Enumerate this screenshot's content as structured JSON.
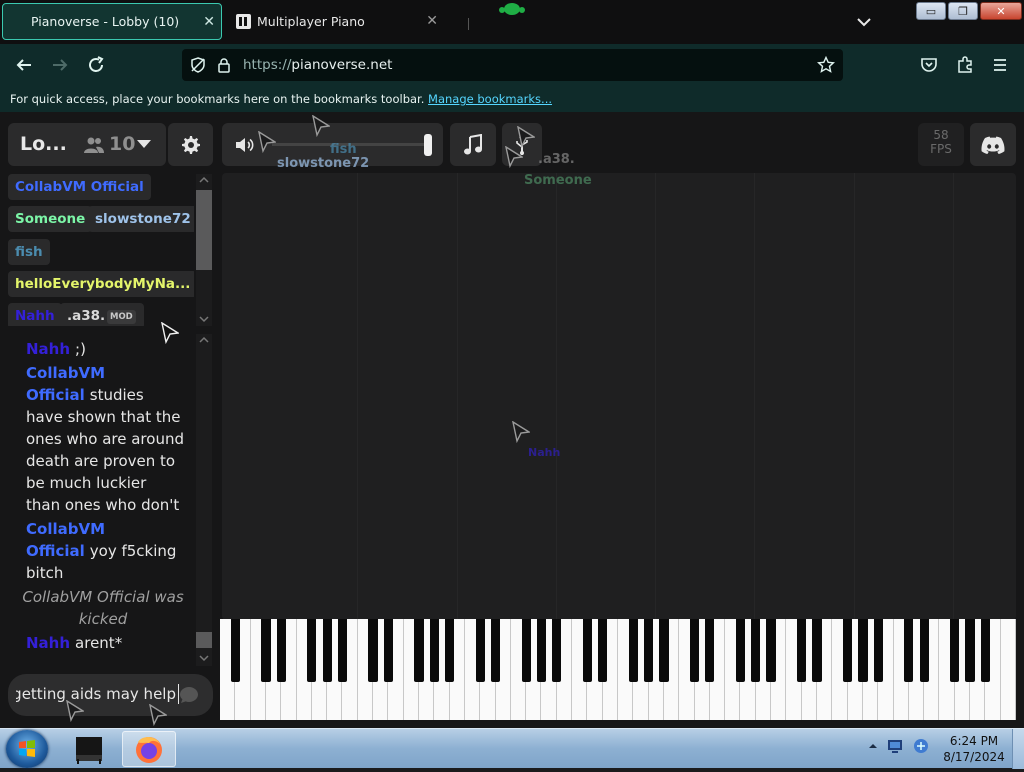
{
  "browser": {
    "tabs": [
      {
        "title": "Pianoverse - Lobby (10)",
        "active": true
      },
      {
        "title": "Multiplayer Piano",
        "active": false
      }
    ],
    "url_prefix": "https://",
    "url_host": "pianoverse.net",
    "bookmarks_msg": "For quick access, place your bookmarks here on the bookmarks toolbar.",
    "bookmarks_link": "Manage bookmarks...",
    "window_buttons": {
      "minimize": "▭",
      "restore": "❐",
      "close": "✕"
    }
  },
  "room": {
    "name": "Lo...",
    "user_count": "10"
  },
  "users": [
    {
      "name": "CollabVM Official",
      "color": "#3f6bff"
    },
    {
      "name": "Someone",
      "color": "#7cf5a7"
    },
    {
      "name": "slowstone72",
      "color": "#9fc3ea"
    },
    {
      "name": "fish",
      "color": "#4b8caf"
    },
    {
      "name": "helloEverybodyMyNa...",
      "color": "#e4f56b"
    },
    {
      "name": "Nahh",
      "color": "#3420d8"
    },
    {
      "name": ".a38.",
      "color": "#d9d9d9",
      "badge": "MOD"
    }
  ],
  "chat": [
    {
      "name": "Nahh",
      "name_color": "#3420d8",
      "text": ";)"
    },
    {
      "name": "CollabVM Official",
      "name_color": "#3f6bff",
      "text": "studies have shown that the ones who are around death are proven to be much luckier than ones who don't"
    },
    {
      "name": "CollabVM Official",
      "name_color": "#3f6bff",
      "text": "yoy f5cking bitch"
    },
    {
      "notice": "CollabVM Official was kicked"
    },
    {
      "name": "Nahh",
      "name_color": "#3420d8",
      "text": "arent*"
    }
  ],
  "chat_input": {
    "value": "getting aids may help"
  },
  "fps": {
    "value": "58",
    "label": "FPS"
  },
  "cursors": [
    {
      "label": "fish"
    },
    {
      "label": "slowstone72"
    },
    {
      "label": ".a38."
    },
    {
      "label": "Someone"
    },
    {
      "label": "Nahh"
    }
  ],
  "taskbar": {
    "time": "6:24 PM",
    "date": "8/17/2024"
  },
  "colors": {
    "accent": "#3bc9b0",
    "nav_bg": "#0f2b2a",
    "link": "#55d6ff",
    "page_bg": "#161617"
  }
}
